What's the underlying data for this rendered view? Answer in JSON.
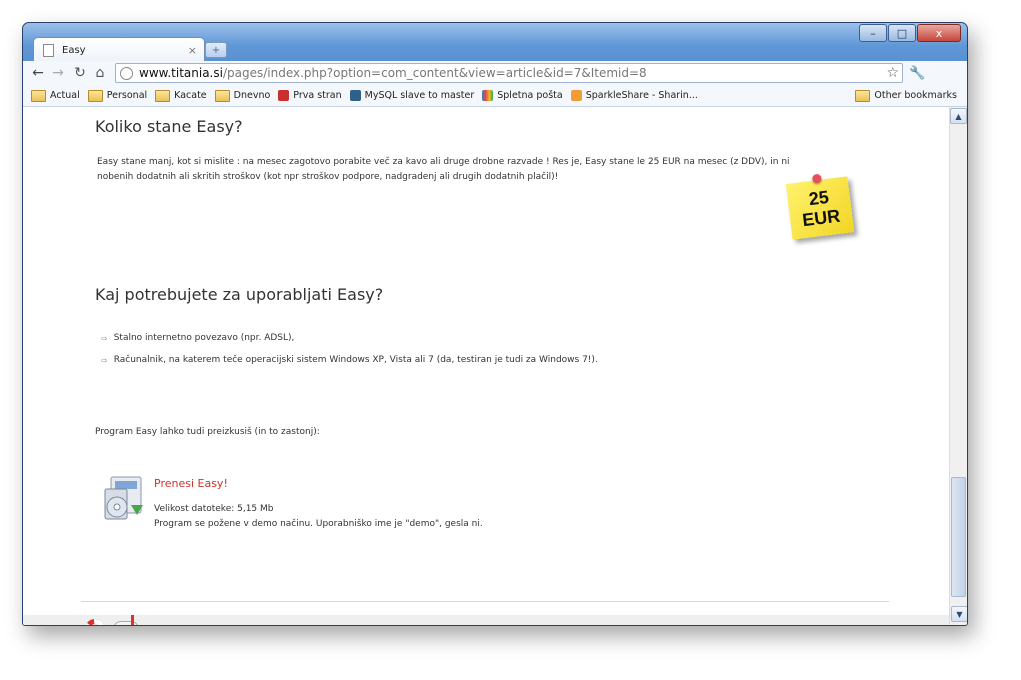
{
  "browser": {
    "tab_title": "Easy",
    "tab_close": "×",
    "new_tab": "+",
    "url_host": "www.titania.si",
    "url_path": "/pages/index.php?option=com_content&view=article&id=7&Itemid=8",
    "window_controls": {
      "minimize": "–",
      "maximize": "□",
      "close": "x"
    }
  },
  "bookmarks": [
    {
      "label": "Actual",
      "icon": "folder"
    },
    {
      "label": "Personal",
      "icon": "folder"
    },
    {
      "label": "Kacate",
      "icon": "folder"
    },
    {
      "label": "Dnevno",
      "icon": "folder"
    },
    {
      "label": "Prva stran",
      "icon": "red-tag"
    },
    {
      "label": "MySQL slave to master",
      "icon": "mysql"
    },
    {
      "label": "Spletna pošta",
      "icon": "google"
    },
    {
      "label": "SparkleShare - Sharin...",
      "icon": "sparkle"
    }
  ],
  "other_bookmarks": "Other bookmarks",
  "page": {
    "section1_title": "Koliko stane Easy?",
    "section1_text": "Easy stane manj, kot si mislite : na mesec zagotovo porabite več za kavo ali druge drobne razvade ! Res je, Easy stane le 25 EUR na mesec (z DDV), in ni nobenih dodatnih ali skritih stroškov (kot npr stroškov podpore, nadgradenj ali drugih dodatnih plačil)!",
    "sticky_line1": "25",
    "sticky_line2": "EUR",
    "section2_title": "Kaj potrebujete za uporabljati Easy?",
    "requirements": [
      "Stalno internetno povezavo (npr. ADSL),",
      "Računalnik, na katerem teče operacijski sistem Windows XP, Vista ali 7 (da, testiran je tudi za Windows 7!)."
    ],
    "try_text": "Program Easy lahko tudi preizkusiš (in to zastonj):",
    "download_title": "Prenesi Easy!",
    "download_size": "Velikost datoteke: 5,15 Mb",
    "download_note": "Program se požene v demo načinu. Uporabniško ime je \"demo\", gesla ni."
  }
}
